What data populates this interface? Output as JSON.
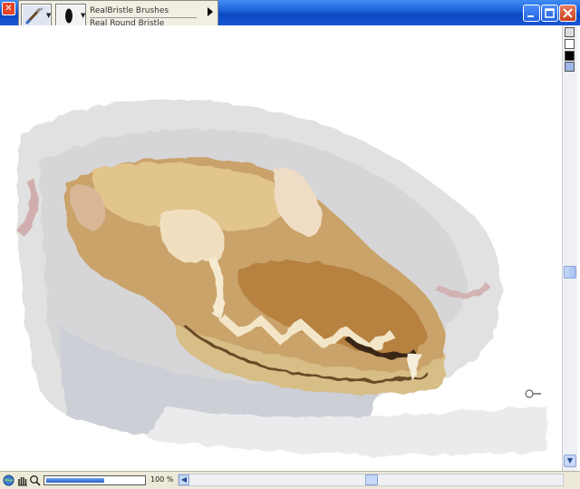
{
  "brush_bar": {
    "category_name": "RealBristle Brushes",
    "variant_name": "Real Round Bristle",
    "category_icon": "paintbrush-icon",
    "variant_icon": "round-dab-icon"
  },
  "window": {
    "minimize_icon": "minimize-icon",
    "maximize_icon": "maximize-icon",
    "close_icon": "close-icon"
  },
  "status_bar": {
    "zoom_percent": "100 %",
    "zoom_level": 0.6
  },
  "colors": {
    "titlebar_blue": "#1a5fd6",
    "close_red": "#c9401e",
    "panel_beige": "#ece9d8"
  }
}
